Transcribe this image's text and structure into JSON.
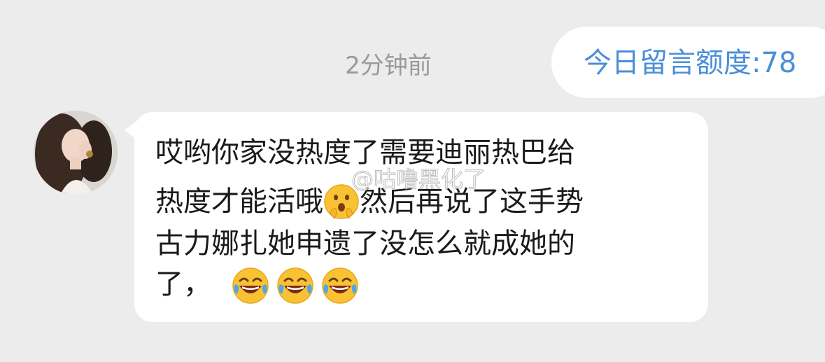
{
  "chat": {
    "timestamp": "2分钟前",
    "quota_text": "今日留言额度:78",
    "message": {
      "line1": "哎哟你家没热度了需要迪丽热巴给",
      "line2_before": "热度才能活哦",
      "line2_emoji": "shocked-emoji",
      "line2_after": "然后再说了这手势",
      "line3": "古力娜扎她申遗了没怎么就成她的",
      "line4": "了，",
      "line4_emojis": [
        "laugh-cry-emoji",
        "laugh-cry-emoji",
        "laugh-cry-emoji"
      ]
    },
    "watermark": "@咕噜黑化了"
  },
  "colors": {
    "background": "#ececec",
    "bubble": "#ffffff",
    "quota_text": "#4a8fd8",
    "timestamp": "#9a9a9a",
    "message_text": "#1a1a1a"
  }
}
